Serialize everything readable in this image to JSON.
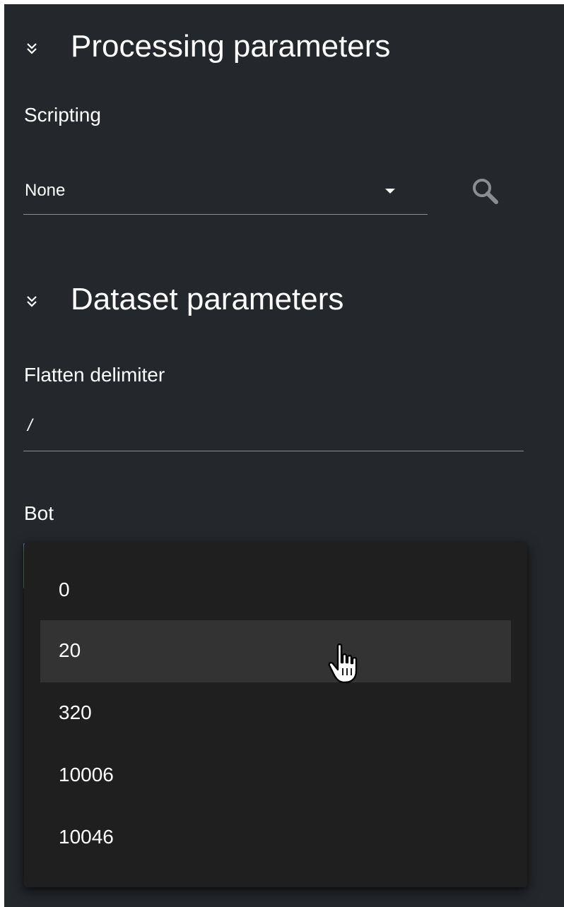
{
  "sections": {
    "processing": {
      "title": "Processing parameters",
      "scripting": {
        "label": "Scripting",
        "value": "None"
      }
    },
    "dataset": {
      "title": "Dataset parameters",
      "flatten_delimiter": {
        "label": "Flatten delimiter",
        "value": "/"
      },
      "bot": {
        "label": "Bot",
        "options": [
          "0",
          "20",
          "320",
          "10006",
          "10046"
        ],
        "hovered_option": "20"
      }
    }
  },
  "icons": {
    "chevron": "double-chevron-down-icon",
    "search": "search-icon",
    "cursor": "hand-pointer-cursor"
  },
  "colors": {
    "panel_bg": "#24272b",
    "menu_bg": "#1f1f1f",
    "menu_hover": "#333333",
    "accent": "#5b6fd6"
  }
}
